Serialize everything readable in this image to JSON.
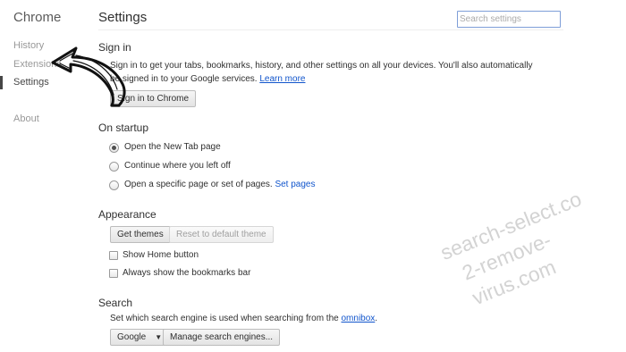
{
  "sidebar": {
    "title": "Chrome",
    "items": [
      {
        "label": "History"
      },
      {
        "label": "Extensions"
      },
      {
        "label": "Settings"
      },
      {
        "label": "About"
      }
    ]
  },
  "header": {
    "title": "Settings",
    "search_placeholder": "Search settings"
  },
  "sign_in": {
    "title": "Sign in",
    "description_line1": "Sign in to get your tabs, bookmarks, history, and other settings on all your devices. You'll also automatically",
    "description_line2": "be signed in to your Google services.",
    "learn_more": "Learn more",
    "button": "Sign in to Chrome"
  },
  "on_startup": {
    "title": "On startup",
    "options": [
      {
        "label": "Open the New Tab page",
        "checked": true
      },
      {
        "label": "Continue where you left off",
        "checked": false
      },
      {
        "label": "Open a specific page or set of pages.",
        "checked": false
      }
    ],
    "set_pages_link": "Set pages"
  },
  "appearance": {
    "title": "Appearance",
    "get_themes": "Get themes",
    "reset_theme": "Reset to default theme",
    "show_home_button": "Show Home button",
    "show_bookmarks_bar": "Always show the bookmarks bar"
  },
  "search": {
    "title": "Search",
    "description": "Set which search engine is used when searching from the",
    "omnibox_link": "omnibox",
    "description_end": ".",
    "engine_selected": "Google",
    "manage_button": "Manage search engines..."
  },
  "watermark": {
    "line1": "search-select.co",
    "line2": "2-remove-virus.com"
  },
  "colors": {
    "link": "#1155cc",
    "search_border": "#7e9ed8",
    "watermark": "#c9c9c9"
  }
}
